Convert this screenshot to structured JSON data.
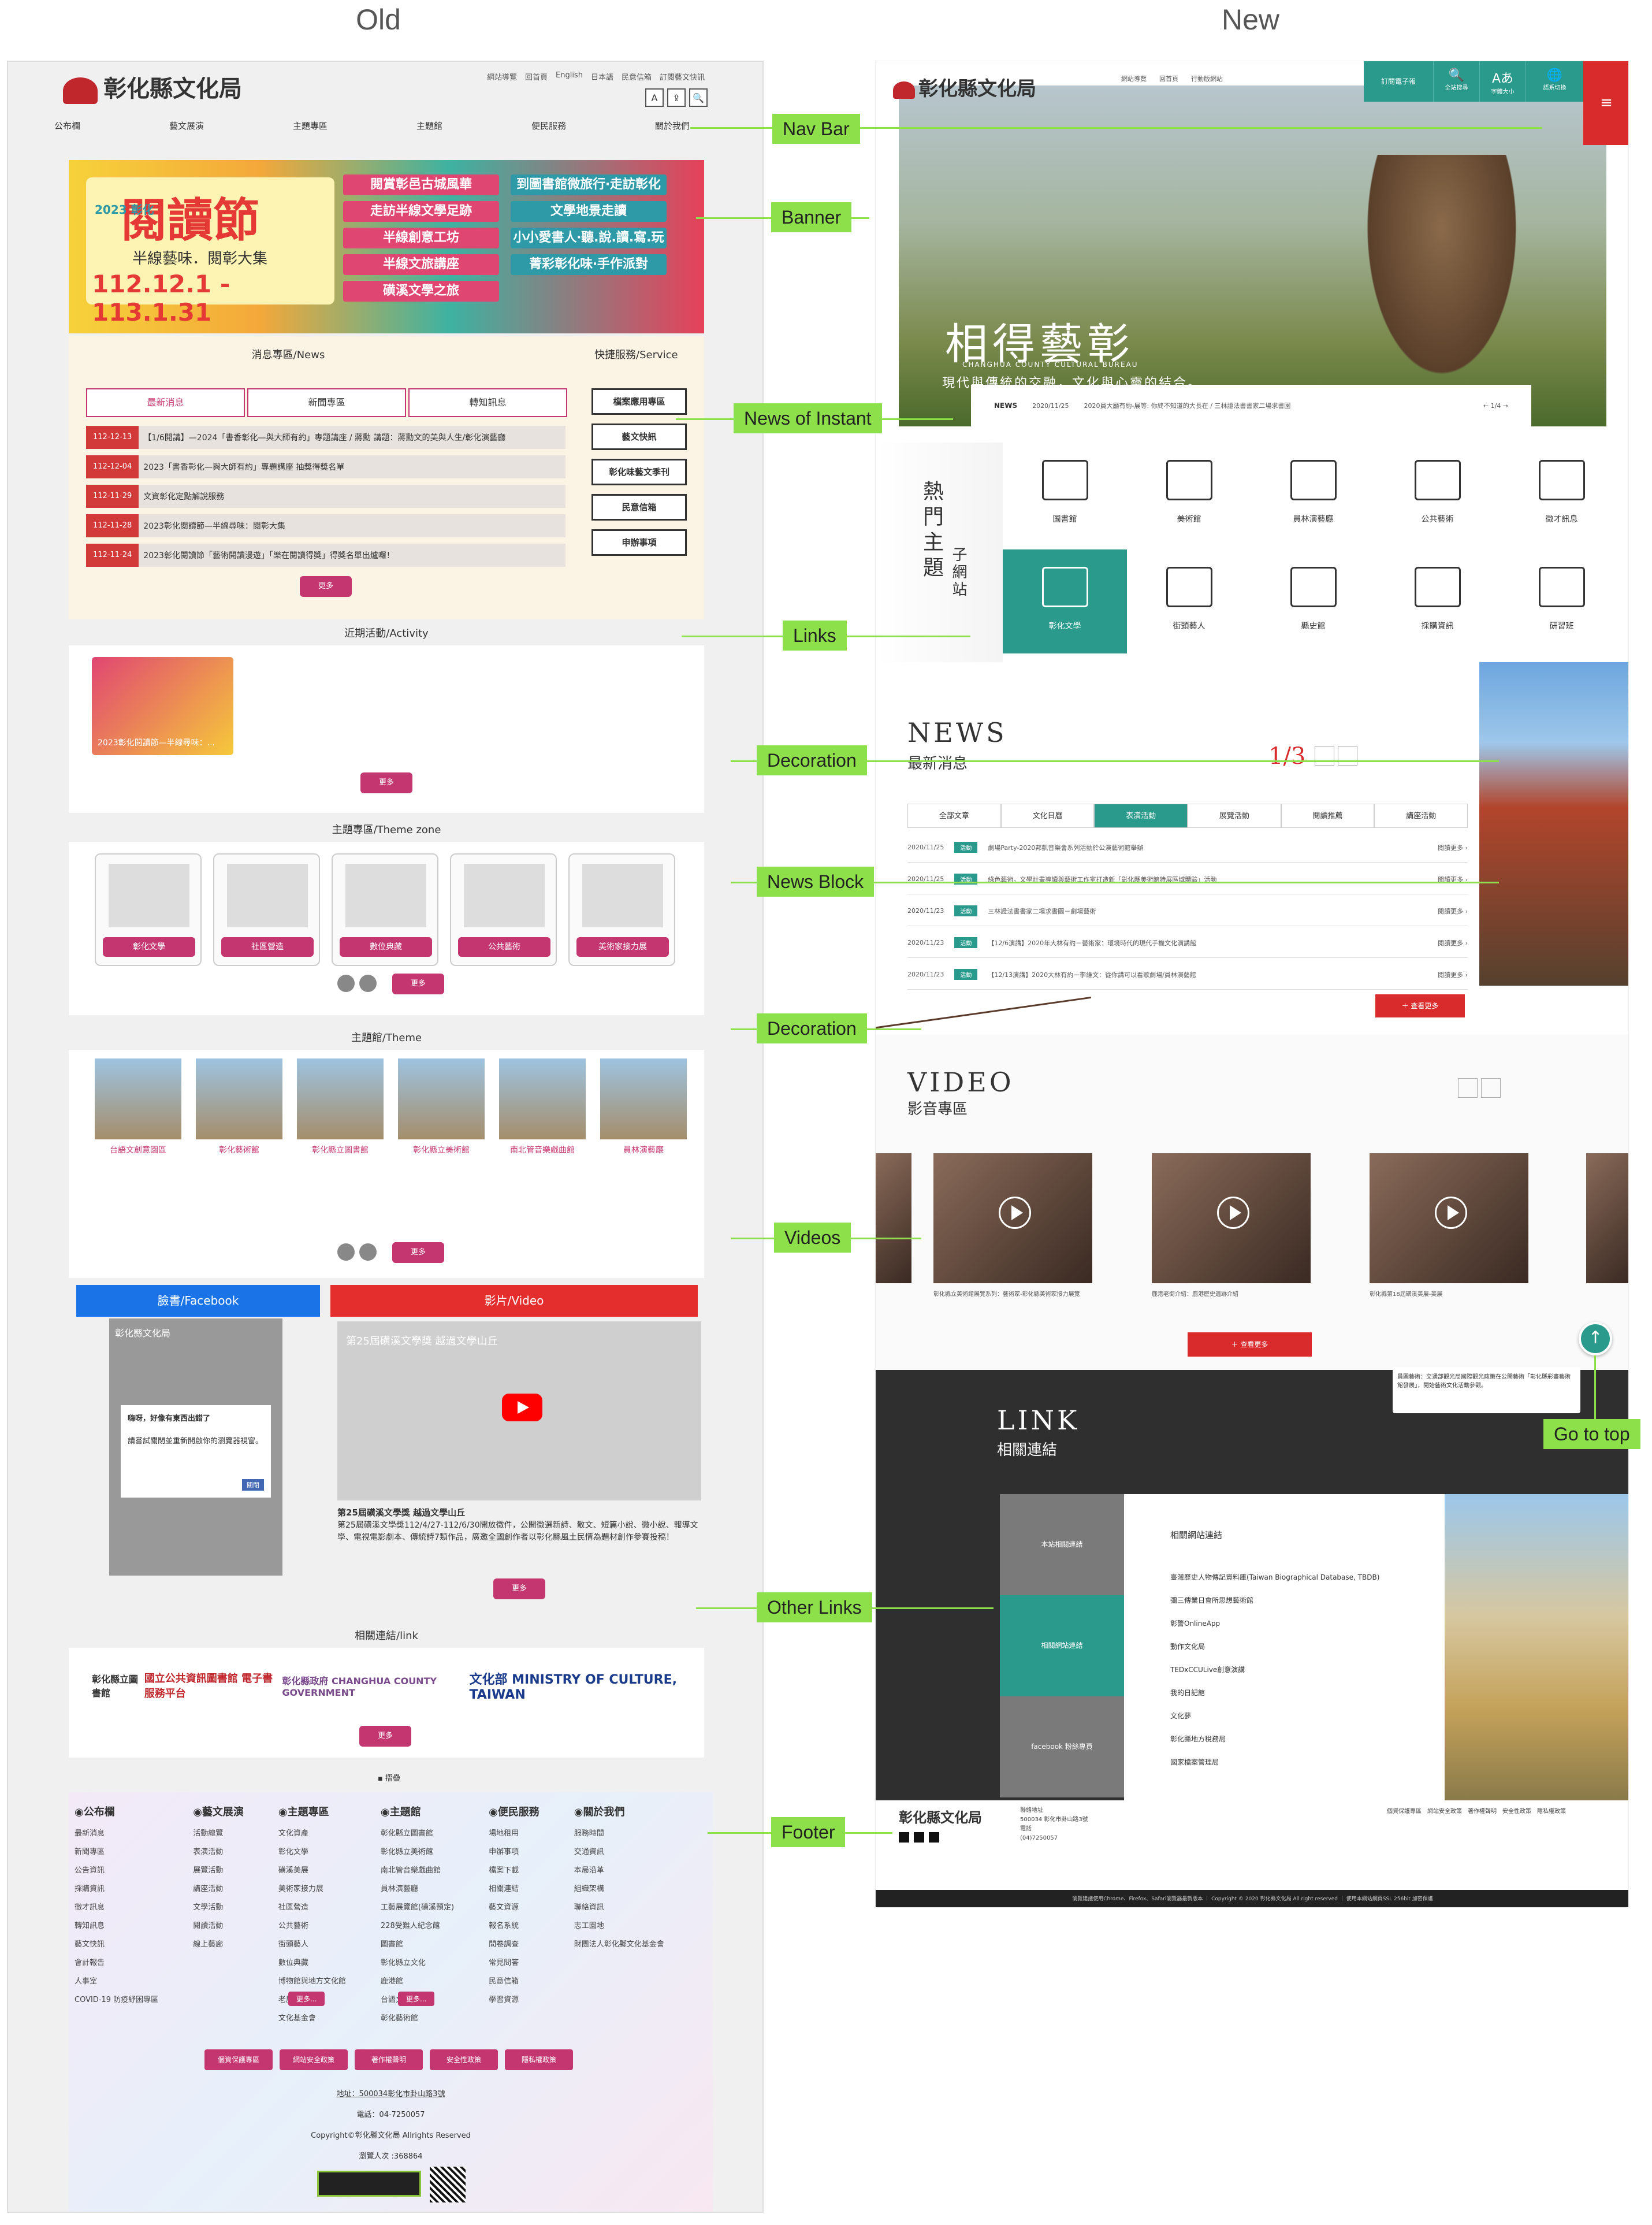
{
  "headings": {
    "old": "Old",
    "new": "New"
  },
  "annotations": [
    "Nav Bar",
    "Banner",
    "News of Instant",
    "Links",
    "Decoration",
    "News Block",
    "Decoration",
    "Videos",
    "Go to top",
    "Other Links",
    "Footer"
  ],
  "old": {
    "logo": "彰化縣文化局",
    "util_links": [
      "網站導覽",
      "回首頁",
      "English",
      "日本語",
      "民意信箱",
      "訂閱藝文快訊"
    ],
    "tools": [
      "A",
      "⇪",
      "🔍"
    ],
    "nav": [
      "公布欄",
      "藝文展演",
      "主題專區",
      "主題館",
      "便民服務",
      "關於我們"
    ],
    "banner": {
      "small": "2023 彰化",
      "title": "閱讀節",
      "sub": "半線藝味．閱彰大集",
      "dates": "112.12.1 - 113.1.31",
      "tags": [
        "閱賞彰邑古城風華",
        "到圖書館微旅行‧走訪彰化",
        "走訪半線文學足跡",
        "文學地景走讀",
        "半線創意工坊",
        "小小愛書人‧聽.說.讀.寫.玩",
        "半線文旅講座",
        "菁彩彰化味‧手作派對",
        "磺溪文學之旅"
      ]
    },
    "news": {
      "title": "消息專區/News",
      "service_title": "快捷服務/Service",
      "tabs": [
        "最新消息",
        "新聞專區",
        "轉知訊息"
      ],
      "items": [
        {
          "date": "112-12-13",
          "text": "【1/6開講】—2024「書香彰化—與大師有約」專題講座 / 蔣勳 講題：蔣勳文的美與人生/彰化演藝廳"
        },
        {
          "date": "112-12-04",
          "text": "2023「書香彰化—與大師有約」專題講座 抽獎得獎名單"
        },
        {
          "date": "112-11-29",
          "text": "文資彰化定點解說服務"
        },
        {
          "date": "112-11-28",
          "text": "2023彰化閱讀節—半線尋味：閱彰大集"
        },
        {
          "date": "112-11-24",
          "text": "2023彰化閱讀節「藝術閱讀漫遊」「樂在閱讀得獎」得獎名單出爐囉！"
        }
      ],
      "more": "更多",
      "services": [
        "檔案應用專區",
        "藝文快訊",
        "彰化味藝文季刊",
        "民意信箱",
        "申辦事項"
      ]
    },
    "activity": {
      "title": "近期活動/Activity",
      "card": "2023彰化閱讀節—半線尋味：...",
      "more": "更多"
    },
    "theme_zone": {
      "title": "主題專區/Theme zone",
      "cards": [
        "彰化文學",
        "社區營造",
        "數位典藏",
        "公共藝術",
        "美術家接力展"
      ],
      "more": "更多"
    },
    "theme": {
      "title": "主題館/Theme",
      "cards": [
        "台語文創意園區",
        "彰化藝術館",
        "彰化縣立圖書館",
        "彰化縣立美術館",
        "南北管音樂戲曲館",
        "員林演藝廳"
      ],
      "more": "更多"
    },
    "facebook": {
      "title": "臉書/Facebook",
      "page": "彰化縣文化局",
      "dialog": "嗨呀，好像有東西出錯了",
      "dialog_body": "請嘗試關閉並重新開啟你的瀏覽器視窗。",
      "close": "關閉"
    },
    "video": {
      "title": "影片/Video",
      "caption": "第25屆磺溪文學獎 越過文學山丘",
      "desc_title": "第25屆磺溪文學獎 越過文學山丘",
      "desc": "第25屆磺溪文學獎112/4/27-112/6/30開放徵件，公開徵選新詩、散文、短篇小說、微小說、報導文學、電視電影劇本、傳統詩7類作品，廣邀全國創作者以彰化縣風土民情為題材創作參賽投稿！",
      "more": "更多"
    },
    "links": {
      "title": "相關連結/link",
      "logos": [
        "彰化縣立圖書館",
        "國立公共資訊圖書館 電子書服務平台",
        "彰化縣政府 CHANGHUA COUNTY GOVERNMENT",
        "文化部 MINISTRY OF CULTURE, TAIWAN"
      ],
      "more": "更多"
    },
    "footer": {
      "toggle": "▪ 摺疊",
      "cols": [
        {
          "h": "◉公布欄",
          "items": [
            "最新消息",
            "新聞專區",
            "公告資訊",
            "採購資訊",
            "徵才訊息",
            "轉知訊息",
            "藝文快訊",
            "會計報告",
            "人事室",
            "COVID-19 防疫紓困專區"
          ]
        },
        {
          "h": "◉藝文展演",
          "items": [
            "活動總覽",
            "表演活動",
            "展覽活動",
            "講座活動",
            "文學活動",
            "閱讀活動",
            "線上藝廊"
          ]
        },
        {
          "h": "◉主題專區",
          "items": [
            "文化資產",
            "彰化文學",
            "磺溪美展",
            "美術家接力展",
            "社區營造",
            "公共藝術",
            "街頭藝人",
            "數位典藏",
            "博物館與地方文化館",
            "老屋計畫",
            "文化基金會"
          ]
        },
        {
          "h": "◉主題館",
          "items": [
            "彰化縣立圖書館",
            "彰化縣立美術館",
            "南北管音樂戲曲館",
            "員林演藝廳",
            "工藝展覽館(磺溪預定)",
            "228受難人紀念館",
            "圖書館",
            "彰化縣立文化",
            "鹿港館",
            "台語文創意園區",
            "彰化藝術館"
          ]
        },
        {
          "h": "◉便民服務",
          "items": [
            "場地租用",
            "申辦事項",
            "檔案下載",
            "相關連結",
            "藝文資源",
            "報名系統",
            "問卷調查",
            "常見問答",
            "民意信箱",
            "學習資源"
          ]
        },
        {
          "h": "◉關於我們",
          "items": [
            "服務時間",
            "交通資訊",
            "本局沿革",
            "組織架構",
            "聯絡資訊",
            "志工園地",
            "財團法人彰化縣文化基金會"
          ]
        }
      ],
      "more": "更多...",
      "buttons": [
        "個資保護專區",
        "網站安全政策",
        "著作權聲明",
        "安全性政策",
        "隱私權政策"
      ],
      "address": "地址：500034彰化市卦山路3號",
      "tel": "電話：04-7250057",
      "copyright": "Copyright©彰化縣文化局 Allrights Reserved",
      "visits": "瀏覽人次 :368864"
    }
  },
  "new": {
    "logo": "彰化縣文化局",
    "util_links": [
      "網站導覽",
      "回首頁",
      "行動版網站"
    ],
    "subscribe": "訂閱電子報",
    "icons": [
      {
        "g": "🔍",
        "t": "全站搜尋"
      },
      {
        "g": "Aあ",
        "t": "字體大小"
      },
      {
        "g": "🌐",
        "t": "語系切換"
      }
    ],
    "menu": "≡",
    "hero": {
      "title": "相得藝彰",
      "en": "CHANGHUA COUNTY CULTURAL BUREAU",
      "sub": "現代與傳統的交融，文化與心靈的結合。"
    },
    "newsbar": {
      "label": "NEWS",
      "date": "2020/11/25",
      "text": "2020員大廳有約-展等: 你終不知道的大長在 / 三林證法書書家二場求書園",
      "pager": "← 1/4 →"
    },
    "hot": {
      "title": "熱門主題",
      "sub": "子網站",
      "items": [
        "圖書館",
        "美術館",
        "員林演藝廳",
        "公共藝術",
        "徵才訊息",
        "彰化文學",
        "街頭藝人",
        "縣史館",
        "採購資訊",
        "研習班"
      ]
    },
    "news": {
      "en": "NEWS",
      "zh": "最新消息",
      "page": "1/3",
      "tabs": [
        "全部文章",
        "文化日曆",
        "表演活動",
        "展覽活動",
        "閱讀推薦",
        "講座活動"
      ],
      "rows": [
        {
          "date": "2020/11/25",
          "tag": "活動",
          "text": "劇場Party-2020邦凱音樂會系列活動於公演藝術館舉辦",
          "more": "閱讀更多 ›"
        },
        {
          "date": "2020/11/25",
          "tag": "活動",
          "text": "綠色藝術，文學計畫導讀與藝術工作室打造新「彰化縣美術館特展區域體驗」活動",
          "more": "閱讀更多 ›"
        },
        {
          "date": "2020/11/23",
          "tag": "活動",
          "text": "三林證法書書家二場求書園－劇場藝術",
          "more": "閱讀更多 ›"
        },
        {
          "date": "2020/11/23",
          "tag": "活動",
          "text": "【12/6演講】2020年大林有約－藝術家：環境時代的現代手機文化演講館",
          "more": "閱讀更多 ›"
        },
        {
          "date": "2020/11/23",
          "tag": "活動",
          "text": "【12/13演講】2020大林有約－李維文：從你講可以看歌劇場/員林演藝館",
          "more": "閱讀更多 ›"
        }
      ],
      "button": "＋ 查看更多"
    },
    "video": {
      "en": "VIDEO",
      "zh": "影音專區",
      "captions": [
        "彰化縣立美術館展覽系列：藝術家-彰化縣美術家接力展覽",
        "鹿港老街介紹：鹿港歷史遺跡介紹",
        "彰化縣第18屆磺溪美展-美展",
        ""
      ],
      "button": "＋ 查看更多"
    },
    "link": {
      "en": "LINK",
      "zh": "相關連結",
      "tabs": [
        "本站相關連結",
        "相關網站連結",
        "facebook 粉絲專頁"
      ],
      "panel_title": "相關網站連結",
      "items": [
        "臺灣歷史人物傳記資料庫(Taiwan Biographical Database, TBDB)",
        "彌三傳業日會所思想藝術館",
        "彰警OnlineApp",
        "動作文化局",
        "TEDxCCULive創意演講",
        "我的日記館",
        "文化夢",
        "彰化縣地方稅務局",
        "國家檔案管理局"
      ]
    },
    "footer": {
      "logo": "彰化縣文化局",
      "address": "聯絡地址\n500034 彰化市卦山路3號\n電話\n(04)7250057",
      "links": [
        "個資保護專區",
        "網站安全政策",
        "著作權聲明",
        "安全性政策",
        "隱私權政策"
      ],
      "bar": "瀏覽建議使用Chrome、Firefox、Safari瀏覽器最新版本 ｜ Copyright © 2020 彰化縣文化局 All right reserved ｜ 使用本網站網頁SSL 256bit 加密保護"
    },
    "tooltip": "員圖藝術：交通部觀光局國際觀光政策在公開藝術「彰化縣彩畫藝術館發展」，開始藝術文化活動參觀。",
    "gotop": "↑"
  }
}
